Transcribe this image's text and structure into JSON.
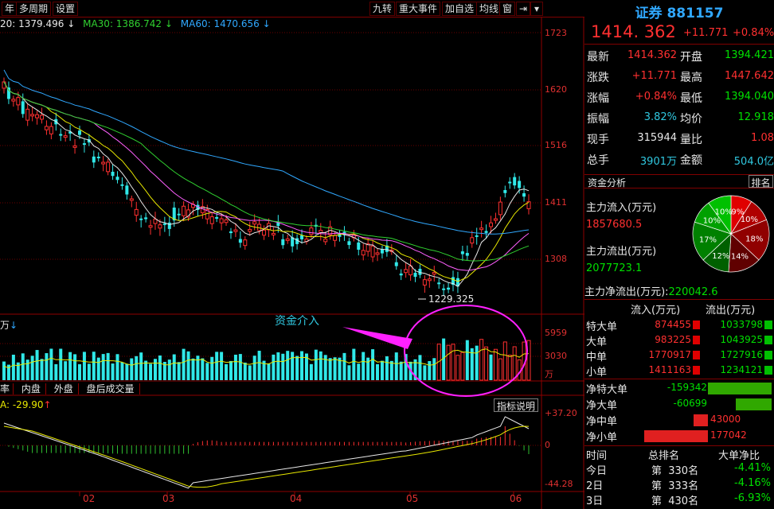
{
  "toolbar": {
    "left_tabs": [
      "年",
      "多周期",
      "设置"
    ],
    "right_tabs": [
      "九转",
      "重大事件",
      "加自选",
      "均线",
      "窗"
    ],
    "export_icon": "export-icon",
    "dropdown_icon": "chevron-down-icon"
  },
  "ma_legend": {
    "ma20": "20: 1379.496",
    "ma30": "MA30: 1386.742",
    "ma60": "MA60: 1470.656",
    "arrow": "↓",
    "colors": {
      "ma20": "#ff60ff",
      "ma30": "#30d030",
      "ma60": "#30a8ff"
    }
  },
  "price_axis": [
    "1723",
    "1620",
    "1516",
    "1411",
    "1308"
  ],
  "low_marker": "1229.325",
  "volume": {
    "unit_label": "万",
    "axis": [
      "5959",
      "3030",
      "万"
    ],
    "annotation": "资金介入"
  },
  "bottom_tabs": [
    "率",
    "内盘",
    "外盘",
    "盘后成交量"
  ],
  "macd": {
    "label": "A: -29.90",
    "arrow": "↑",
    "help_button": "指标说明",
    "axis": [
      "+37.20",
      "0",
      "-44.28"
    ]
  },
  "x_axis": [
    "02",
    "03",
    "04",
    "05",
    "06"
  ],
  "quote": {
    "title": "证券 881157",
    "price": "1414. 362",
    "change": "+11.771",
    "change_pct": "+0.84%",
    "rows": [
      {
        "l1": "最新",
        "v1": "1414.362",
        "c1": "red",
        "l2": "开盘",
        "v2": "1394.421",
        "c2": "green"
      },
      {
        "l1": "涨跌",
        "v1": "+11.771",
        "c1": "red",
        "l2": "最高",
        "v2": "1447.642",
        "c2": "red"
      },
      {
        "l1": "涨幅",
        "v1": "+0.84%",
        "c1": "red",
        "l2": "最低",
        "v2": "1394.040",
        "c2": "green"
      },
      {
        "l1": "振幅",
        "v1": "3.82%",
        "c1": "cyan",
        "l2": "均价",
        "v2": "12.918",
        "c2": "green"
      },
      {
        "l1": "现手",
        "v1": "315944",
        "c1": "white",
        "l2": "量比",
        "v2": "1.08",
        "c2": "red"
      },
      {
        "l1": "总手",
        "v1": "3901万",
        "c1": "cyan",
        "l2": "金额",
        "v2": "504.0亿",
        "c2": "cyan"
      }
    ]
  },
  "capital": {
    "section_title": "资金分析",
    "rank_button": "排名",
    "inflow_label": "主力流入(万元)",
    "inflow_value": "1857680.5",
    "outflow_label": "主力流出(万元)",
    "outflow_value": "2077723.1",
    "net_label": "主力净流出(万元):",
    "net_value": "220042.6",
    "pie": [
      {
        "label": "9%",
        "color": "#e00000"
      },
      {
        "label": "10%",
        "color": "#b00000"
      },
      {
        "label": "18%",
        "color": "#900000"
      },
      {
        "label": "14%",
        "color": "#600000"
      },
      {
        "label": "12%",
        "color": "#006000"
      },
      {
        "label": "17%",
        "color": "#008000"
      },
      {
        "label": "10%",
        "color": "#00a000"
      },
      {
        "label": "10%",
        "color": "#00c000"
      }
    ],
    "flow_header": [
      "流入(万元)",
      "流出(万元)"
    ],
    "flow_rows": [
      {
        "name": "特大单",
        "in": "874455",
        "out": "1033798"
      },
      {
        "name": "大单",
        "in": "983225",
        "out": "1043925"
      },
      {
        "name": "中单",
        "in": "1770917",
        "out": "1727916"
      },
      {
        "name": "小单",
        "in": "1411163",
        "out": "1234121"
      }
    ],
    "net_rows": [
      {
        "name": "净特大单",
        "value": "-159342",
        "color": "green"
      },
      {
        "name": "净大单",
        "value": "-60699",
        "color": "green"
      },
      {
        "name": "净中单",
        "value": "43000",
        "color": "red"
      },
      {
        "name": "净小单",
        "value": "177042",
        "color": "red"
      }
    ],
    "rank_header": [
      "时间",
      "总排名",
      "大单净比"
    ],
    "rank_rows": [
      {
        "day": "今日",
        "rank": "第  330名",
        "ratio": "-4.41%"
      },
      {
        "day": "2日",
        "rank": "第  333名",
        "ratio": "-4.16%"
      },
      {
        "day": "3日",
        "rank": "第  430名",
        "ratio": "-6.93%"
      }
    ]
  }
}
